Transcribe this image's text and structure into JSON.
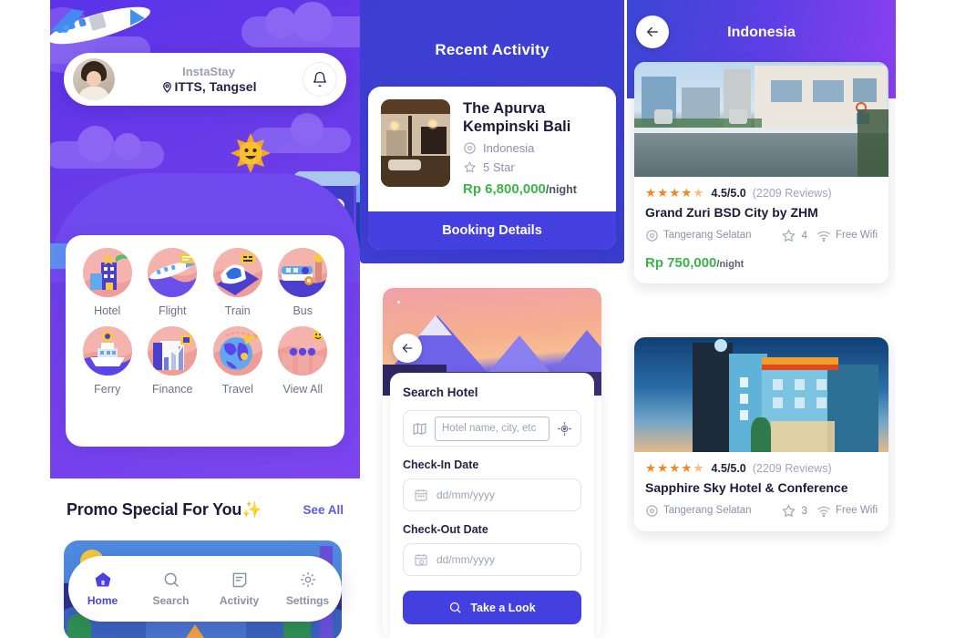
{
  "left": {
    "profile": {
      "avatar_icon": "user-avatar-photo",
      "brand": "InstaStay",
      "location_icon": "location-pin-icon",
      "location": "ITTS, Tangsel",
      "bell_icon": "notification-bell-icon"
    },
    "categories": [
      {
        "label": "Hotel",
        "icon": "hotel-icon"
      },
      {
        "label": "Flight",
        "icon": "flight-icon"
      },
      {
        "label": "Train",
        "icon": "train-icon"
      },
      {
        "label": "Bus",
        "icon": "bus-icon"
      },
      {
        "label": "Ferry",
        "icon": "ferry-icon"
      },
      {
        "label": "Finance",
        "icon": "finance-icon"
      },
      {
        "label": "Travel",
        "icon": "travel-icon"
      },
      {
        "label": "View All",
        "icon": "view-all-icon"
      }
    ],
    "promo": {
      "title": "Promo Special For You✨",
      "see_all": "See All"
    },
    "nav": [
      {
        "label": "Home",
        "icon": "home-icon",
        "active": true
      },
      {
        "label": "Search",
        "icon": "search-icon",
        "active": false
      },
      {
        "label": "Activity",
        "icon": "activity-icon",
        "active": false
      },
      {
        "label": "Settings",
        "icon": "gear-icon",
        "active": false
      }
    ]
  },
  "middle": {
    "header_title": "Recent Activity",
    "activity": {
      "thumb_icon": "hotel-room-photo",
      "name": "The Apurva Kempinski Bali",
      "location_icon": "location-pin-icon",
      "location": "Indonesia",
      "star_icon": "star-outline-icon",
      "star_text": "5 Star",
      "price": "Rp 6,800,000",
      "price_unit": "/night",
      "booking_button": "Booking Details"
    },
    "search": {
      "back_icon": "back-arrow-icon",
      "heading": "Search Hotel",
      "hotel_field": {
        "map_icon": "map-icon",
        "placeholder": "Hotel name, city, etc",
        "value": "",
        "gps_icon": "gps-target-icon"
      },
      "checkin_label": "Check-In Date",
      "checkin_placeholder": "dd/mm/yyyy",
      "checkin_value": "",
      "checkin_icon": "calendar-icon",
      "checkout_label": "Check-Out Date",
      "checkout_placeholder": "dd/mm/yyyy",
      "checkout_value": "",
      "checkout_icon": "calendar-edit-icon",
      "submit_label": "Take a Look",
      "submit_icon": "search-icon"
    }
  },
  "right": {
    "back_icon": "back-arrow-icon",
    "title": "Indonesia",
    "hotels": [
      {
        "photo_icon": "hotel-pool-photo",
        "stars": "★★★★",
        "half_star": "★",
        "rating": "4.5/5.0",
        "reviews": "(2209 Reviews)",
        "name": "Grand Zuri BSD City by ZHM",
        "location_icon": "location-pin-icon",
        "location": "Tangerang Selatan",
        "star_icon": "star-outline-icon",
        "star_count": "4",
        "wifi_icon": "wifi-icon",
        "wifi_label": "Free Wifi",
        "price": "Rp 750,000",
        "price_unit": "/night"
      },
      {
        "photo_icon": "hotel-building-photo",
        "stars": "★★★★",
        "half_star": "★",
        "rating": "4.5/5.0",
        "reviews": "(2209 Reviews)",
        "name": "Sapphire Sky Hotel & Conference",
        "location_icon": "location-pin-icon",
        "location": "Tangerang Selatan",
        "star_icon": "star-outline-icon",
        "star_count": "3",
        "wifi_icon": "wifi-icon",
        "wifi_label": "Free Wifi",
        "price": "",
        "price_unit": ""
      }
    ]
  },
  "colors": {
    "brand_purple": "#5b33e8",
    "brand_blue": "#4440e0",
    "accent_green": "#3bb54a",
    "star_orange": "#f5881f",
    "gradient_start": "#3b46d4",
    "gradient_end": "#8a3ff0"
  }
}
